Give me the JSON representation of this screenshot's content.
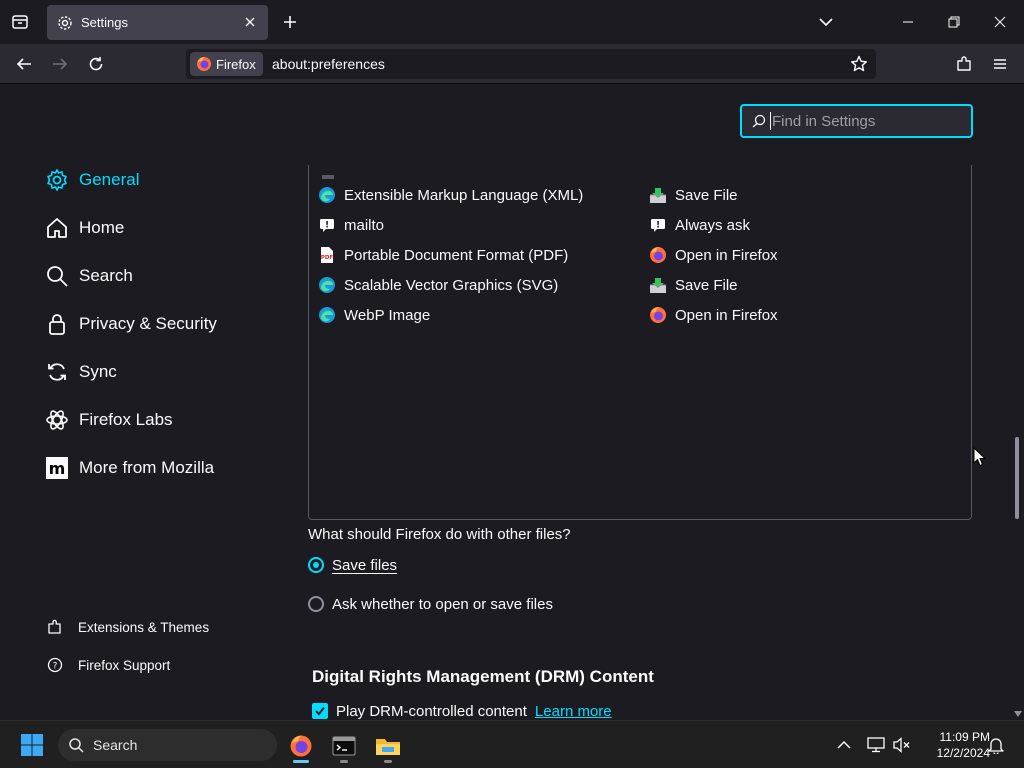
{
  "tabbar": {
    "tab_title": "Settings"
  },
  "navbar": {
    "identity_label": "Firefox",
    "url": "about:preferences"
  },
  "search": {
    "placeholder": "Find in Settings"
  },
  "sidebar": {
    "categories": [
      {
        "label": "General",
        "icon": "gear-icon",
        "selected": true
      },
      {
        "label": "Home",
        "icon": "home-icon"
      },
      {
        "label": "Search",
        "icon": "search-icon"
      },
      {
        "label": "Privacy & Security",
        "icon": "lock-icon"
      },
      {
        "label": "Sync",
        "icon": "sync-icon"
      },
      {
        "label": "Firefox Labs",
        "icon": "flask-icon"
      },
      {
        "label": "More from Mozilla",
        "icon": "mozilla-icon"
      }
    ],
    "footer": [
      {
        "label": "Extensions & Themes",
        "icon": "puzzle-icon"
      },
      {
        "label": "Firefox Support",
        "icon": "help-icon"
      }
    ]
  },
  "applications": {
    "rows": [
      {
        "type": "Extensible Markup Language (XML)",
        "type_icon": "edge-icon",
        "action": "Save File",
        "action_icon": "save-file-icon"
      },
      {
        "type": "mailto",
        "type_icon": "ask-icon",
        "action": "Always ask",
        "action_icon": "ask-icon"
      },
      {
        "type": "Portable Document Format (PDF)",
        "type_icon": "pdf-icon",
        "action": "Open in Firefox",
        "action_icon": "firefox-icon"
      },
      {
        "type": "Scalable Vector Graphics (SVG)",
        "type_icon": "edge-icon",
        "action": "Save File",
        "action_icon": "save-file-icon"
      },
      {
        "type": "WebP Image",
        "type_icon": "edge-icon",
        "action": "Open in Firefox",
        "action_icon": "firefox-icon"
      }
    ]
  },
  "other_files": {
    "question": "What should Firefox do with other files?",
    "option_save": "Save files",
    "option_ask": "Ask whether to open or save files",
    "selected": "Save files"
  },
  "drm": {
    "title": "Digital Rights Management (DRM) Content",
    "checkbox_label": "Play DRM-controlled content",
    "checked": true,
    "learn_more": "Learn more"
  },
  "taskbar": {
    "search_label": "Search",
    "time": "11:09 PM",
    "date": "12/2/2024"
  },
  "colors": {
    "accent": "#00ddff",
    "background": "#1c1b22",
    "toolbar": "#2b2a33",
    "tab": "#42414d"
  }
}
